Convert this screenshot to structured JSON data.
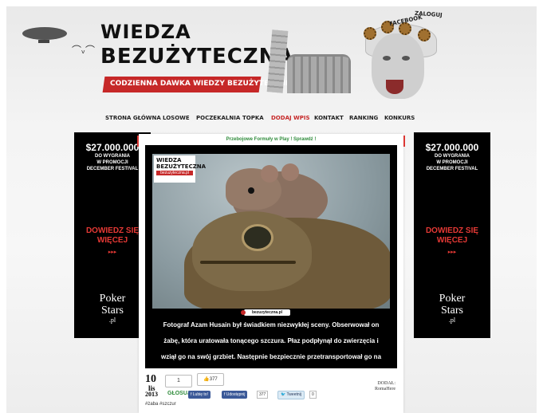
{
  "header": {
    "logo_line1": "WIEDZA",
    "logo_line2": "BEZUŻYTECZNA",
    "tagline": "CODZIENNA DAWKA WIEDZY BEZUŻYTECZNEJ",
    "facebook_tag": "FACEBOOK",
    "zaloguj_tag": "ZALOGUJ"
  },
  "nav": {
    "items": [
      "STRONA GŁÓWNA",
      "LOSOWE",
      "POCZEKALNIA",
      "TOPKA",
      "DODAJ WPIS",
      "KONTAKT",
      "RANKING",
      "KONKURS"
    ],
    "active_color": "#c62828"
  },
  "ads": {
    "amount": "$27.000.000",
    "line1": "DO WYGRANIA",
    "line2": "W PROMOCJI",
    "line3": "DECEMBER FESTIVAL",
    "cta1": "DOWIEDZ SIĘ",
    "cta2": "WIĘCEJ",
    "arrows": "▸▸▸",
    "brand1": "Poker",
    "brand2": "Stars",
    "brand3": ".pl"
  },
  "post": {
    "promo": "Przebojowe Formuły w Play ! Sprawdź !",
    "photo_logo1": "WIEDZA",
    "photo_logo2": "BEZUŻYTECZNA",
    "photo_logo3": "bezuzyteczna.pl",
    "watermark": "bezuzyteczna.pl",
    "caption": "Fotograf Azam Husain był świadkiem niezwykłej sceny. Obserwował on żabę, która uratowała tonącego szczura. Płaz podpłynął do zwierzęcia i wziął go na swój grzbiet. Następnie bezpiecznie przetransportował go na brzeg.",
    "date_day": "10",
    "date_month": "lis",
    "date_year": "2013",
    "vote_count": "1",
    "vote_label": "GŁOSUJ",
    "like_count": "377",
    "fb_like": "Lubię to!",
    "fb_share": "Udostępnij",
    "fb_share_count": "377",
    "tweet": "Tweetnij",
    "tweet_count": "0",
    "added_by_label": "DODAŁ:",
    "added_by": "RomaHere",
    "tags": "#żaba #szczur"
  }
}
